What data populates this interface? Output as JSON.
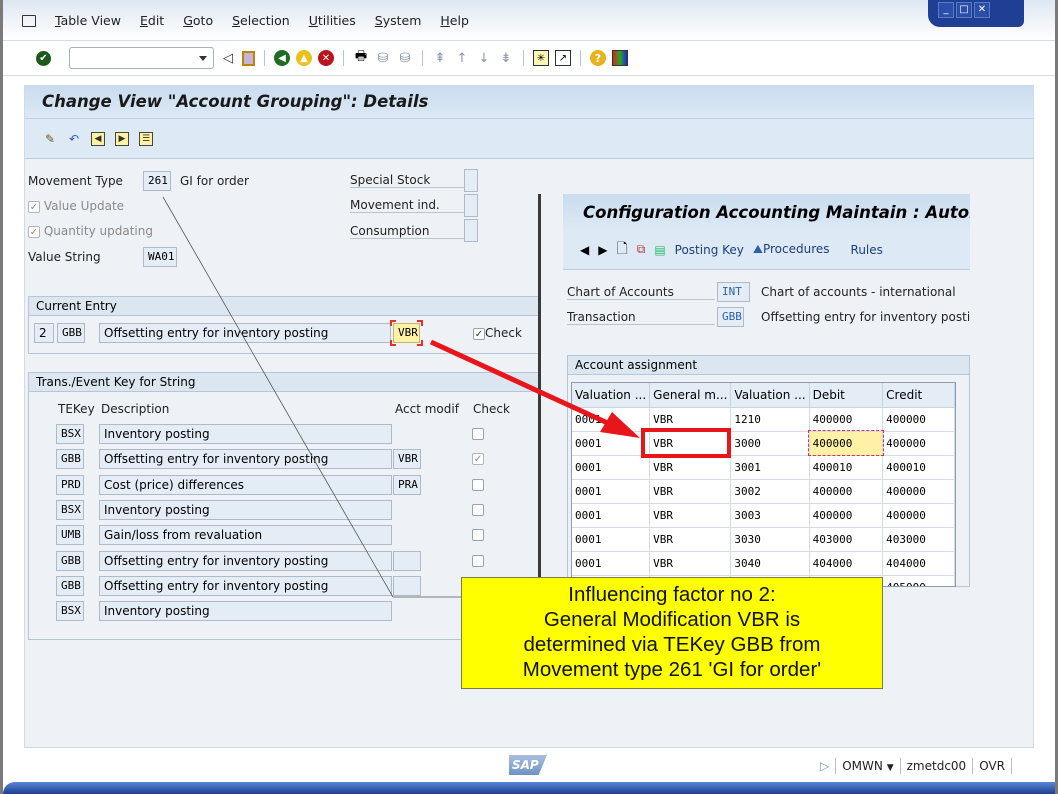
{
  "menubar": {
    "items": [
      "Table View",
      "Edit",
      "Goto",
      "Selection",
      "Utilities",
      "System",
      "Help"
    ]
  },
  "window_controls": [
    "minimize",
    "maximize",
    "close"
  ],
  "toolbar": {
    "command_field_value": "",
    "icons": [
      "enter-icon",
      "back-arrow-icon",
      "save-icon",
      "back-icon",
      "exit-icon",
      "cancel-icon",
      "print-icon",
      "find-icon",
      "find-next-icon",
      "first-page-icon",
      "previous-page-icon",
      "next-page-icon",
      "last-page-icon",
      "new-session-icon",
      "shortcut-icon",
      "help-icon",
      "customize-layout-icon"
    ]
  },
  "main": {
    "title": "Change View \"Account Grouping\": Details",
    "app_toolbar_icons": [
      "display-change-icon",
      "undo-icon",
      "previous-entry-icon",
      "next-entry-icon",
      "variable-list-icon"
    ],
    "movement_type": {
      "label": "Movement Type",
      "value": "261",
      "text": "GI for order"
    },
    "value_update": {
      "label": "Value Update",
      "checked": true
    },
    "quantity_updating": {
      "label": "Quantity updating",
      "checked": true
    },
    "value_string": {
      "label": "Value String",
      "value": "WA01"
    },
    "special_stock": {
      "label": "Special Stock",
      "value": ""
    },
    "movement_ind": {
      "label": "Movement ind.",
      "value": ""
    },
    "consumption": {
      "label": "Consumption",
      "value": ""
    },
    "current_entry": {
      "title": "Current Entry",
      "counter": "2",
      "tekey": "GBB",
      "description": "Offsetting entry for inventory posting",
      "acct_modif": "VBR",
      "check_label": "Check",
      "checked": true
    },
    "trans_event": {
      "title": "Trans./Event Key for String",
      "headers": {
        "tekey": "TEKey",
        "description": "Description",
        "acct_modif": "Acct modif",
        "check": "Check"
      },
      "rows": [
        {
          "tekey": "BSX",
          "description": "Inventory posting",
          "acct_modif": null,
          "check": false
        },
        {
          "tekey": "GBB",
          "description": "Offsetting entry for inventory posting",
          "acct_modif": "VBR",
          "check": true
        },
        {
          "tekey": "PRD",
          "description": "Cost (price) differences",
          "acct_modif": "PRA",
          "check": false
        },
        {
          "tekey": "BSX",
          "description": "Inventory posting",
          "acct_modif": null,
          "check": false
        },
        {
          "tekey": "UMB",
          "description": "Gain/loss from revaluation",
          "acct_modif": null,
          "check": false
        },
        {
          "tekey": "GBB",
          "description": "Offsetting entry for inventory posting",
          "acct_modif": "",
          "check": false
        },
        {
          "tekey": "GBB",
          "description": "Offsetting entry for inventory posting",
          "acct_modif": "",
          "check": null
        },
        {
          "tekey": "BSX",
          "description": "Inventory posting",
          "acct_modif": null,
          "check": null
        }
      ]
    }
  },
  "config_window": {
    "title": "Configuration Accounting Maintain : Automa",
    "toolbar": {
      "posting_key": "Posting Key",
      "procedures": "Procedures",
      "rules": "Rules"
    },
    "chart_of_accounts": {
      "label": "Chart of Accounts",
      "value": "INT",
      "text": "Chart of accounts - international"
    },
    "transaction": {
      "label": "Transaction",
      "value": "GBB",
      "text": "Offsetting entry for inventory posting"
    },
    "account_assignment": {
      "title": "Account assignment",
      "columns": [
        "Valuation ...",
        "General m...",
        "Valuation ...",
        "Debit",
        "Credit"
      ],
      "rows": [
        [
          "0001",
          "VBR",
          "1210",
          "400000",
          "400000"
        ],
        [
          "0001",
          "VBR",
          "3000",
          "400000",
          "400000"
        ],
        [
          "0001",
          "VBR",
          "3001",
          "400010",
          "400010"
        ],
        [
          "0001",
          "VBR",
          "3002",
          "400000",
          "400000"
        ],
        [
          "0001",
          "VBR",
          "3003",
          "400000",
          "400000"
        ],
        [
          "0001",
          "VBR",
          "3030",
          "403000",
          "403000"
        ],
        [
          "0001",
          "VBR",
          "3040",
          "404000",
          "404000"
        ]
      ],
      "partial_next_credit": "405000"
    }
  },
  "annotation": {
    "lines": [
      "Influencing factor no 2:",
      "General Modification VBR is",
      "determined via TEKey GBB from",
      "Movement type 261 'GI for order'"
    ],
    "highlight_color": "#ffff00",
    "arrow_color": "#e8161a"
  },
  "statusbar": {
    "logo": "SAP",
    "transaction": "OMWN",
    "server": "zmetdc00",
    "mode": "OVR"
  }
}
